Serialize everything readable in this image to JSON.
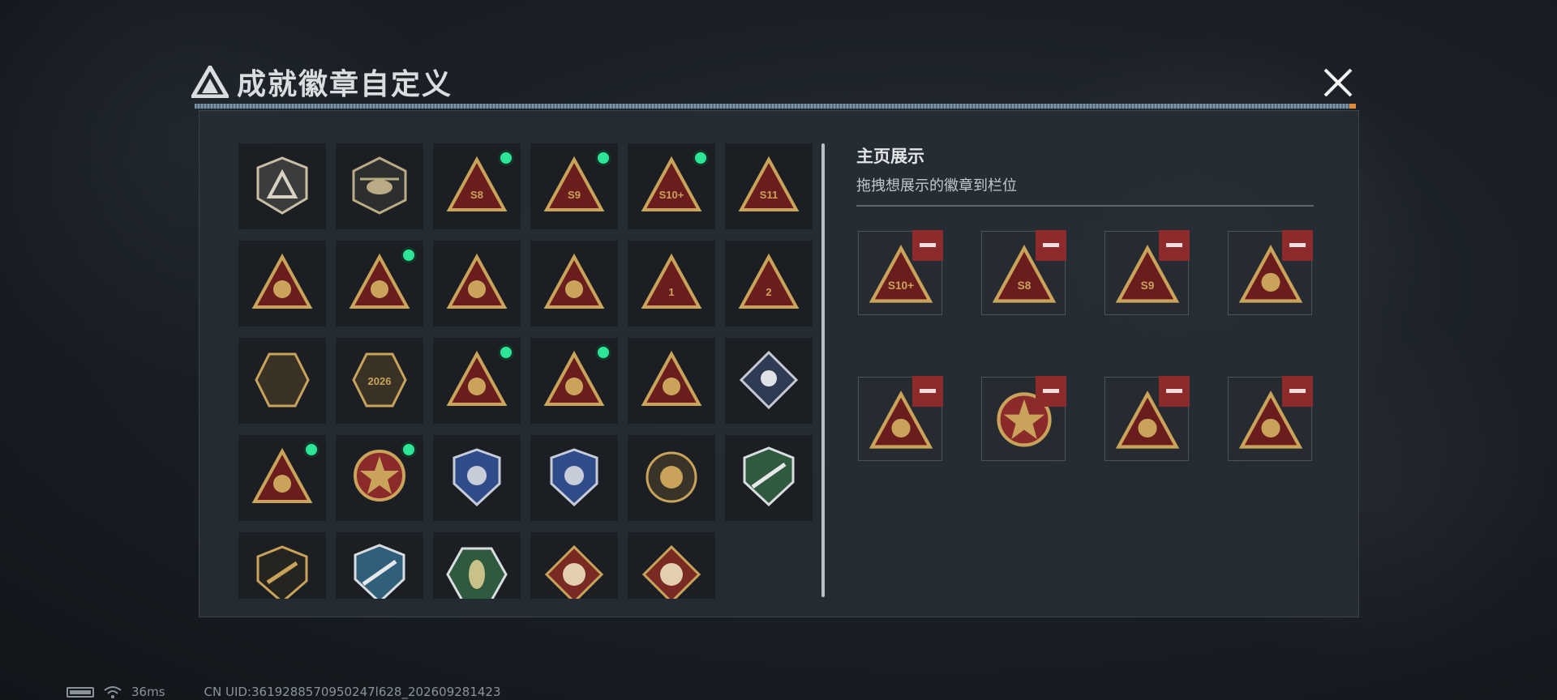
{
  "header": {
    "title": "成就徽章自定义",
    "logo_icon": "delta-logo-icon",
    "close_icon": "close-icon"
  },
  "library": {
    "badges": [
      {
        "icon": "delta-shield-badge-icon",
        "new": false
      },
      {
        "icon": "helicopter-badge-icon",
        "new": false
      },
      {
        "icon": "s8-season-badge-icon",
        "new": true,
        "text": "S8"
      },
      {
        "icon": "s9-season-badge-icon",
        "new": true,
        "text": "S9"
      },
      {
        "icon": "s10-plus-badge-icon",
        "new": true,
        "text": "S10+"
      },
      {
        "icon": "s11-season-badge-icon",
        "new": false,
        "text": "S11"
      },
      {
        "icon": "flower-badge-icon",
        "new": false
      },
      {
        "icon": "shaka-hand-badge-icon",
        "new": true
      },
      {
        "icon": "hands-badge-icon",
        "new": false
      },
      {
        "icon": "bee-badge-icon",
        "new": false
      },
      {
        "icon": "number-one-badge-icon",
        "new": false,
        "text": "1"
      },
      {
        "icon": "number-two-badge-icon",
        "new": false,
        "text": "2"
      },
      {
        "icon": "crocodile-badge-icon",
        "new": false
      },
      {
        "icon": "delta-force-2026-badge-icon",
        "new": false,
        "text": "2026"
      },
      {
        "icon": "usb-badge-icon",
        "new": true
      },
      {
        "icon": "soldiers-badge-icon",
        "new": true
      },
      {
        "icon": "rocket-badge-icon",
        "new": false
      },
      {
        "icon": "rose-badge-icon",
        "new": false
      },
      {
        "icon": "hazmat-badge-icon",
        "new": true
      },
      {
        "icon": "star-medal-badge-icon",
        "new": true
      },
      {
        "icon": "blue-shield-badge-icon",
        "new": false
      },
      {
        "icon": "blue-diamond-shield-badge-icon",
        "new": false
      },
      {
        "icon": "skull-target-badge-icon",
        "new": false
      },
      {
        "icon": "green-rifle-badge-icon",
        "new": false
      },
      {
        "icon": "rifle-shield-badge-icon",
        "new": false
      },
      {
        "icon": "knife-shield-badge-icon",
        "new": false
      },
      {
        "icon": "scorpion-badge-icon",
        "new": false
      },
      {
        "icon": "dragon-badge-icon",
        "new": false
      },
      {
        "icon": "runner-badge-icon",
        "new": false
      }
    ]
  },
  "showcase": {
    "title": "主页展示",
    "subtitle": "拖拽想展示的徽章到栏位",
    "slots": [
      {
        "icon": "s10-plus-badge-icon",
        "text": "S10+"
      },
      {
        "icon": "s8-season-badge-icon",
        "text": "S8"
      },
      {
        "icon": "s9-season-badge-icon",
        "text": "S9"
      },
      {
        "icon": "shaka-hand-badge-icon"
      },
      {
        "icon": "usb-badge-icon"
      },
      {
        "icon": "star-medal-badge-icon"
      },
      {
        "icon": "hazmat-badge-icon"
      },
      {
        "icon": "soldiers-badge-icon"
      }
    ]
  },
  "status_bar": {
    "ping": "36ms",
    "uid": "CN UID:3619288570950247l628_202609281423"
  },
  "colors": {
    "gold": "#c9a35a",
    "red": "#8c2a2c",
    "new_dot": "#2ee596",
    "dark_red": "#6b1d1d"
  }
}
